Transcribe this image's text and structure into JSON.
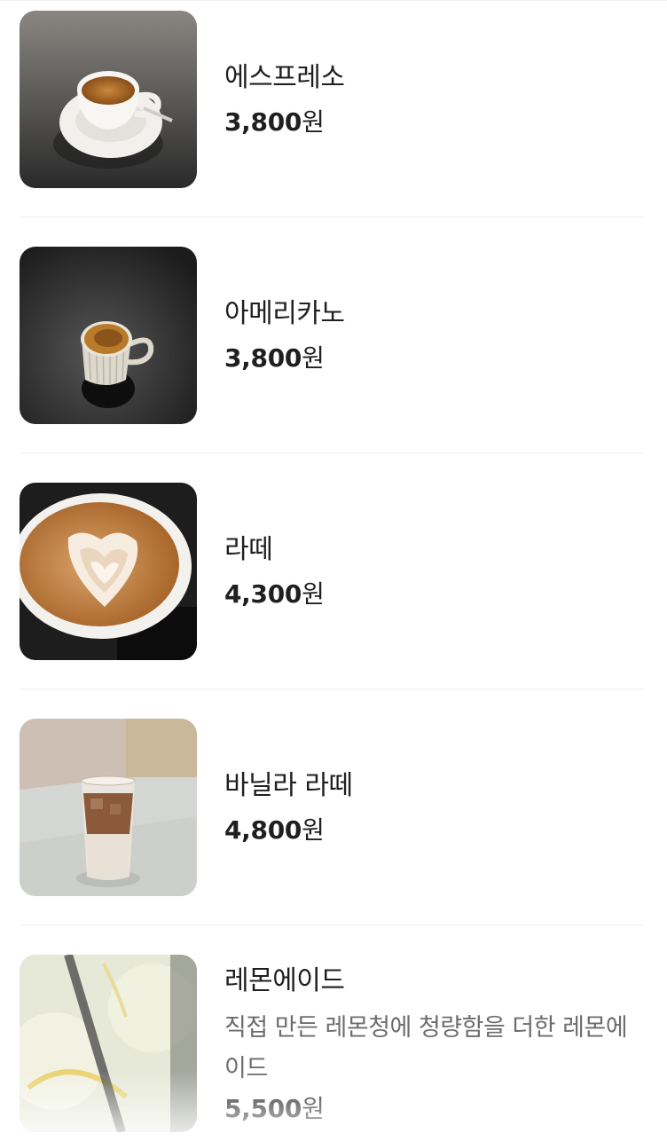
{
  "menu": {
    "items": [
      {
        "name": "에스프레소",
        "price": "3,800",
        "currency": "원",
        "image": "espresso-photo"
      },
      {
        "name": "아메리카노",
        "price": "3,800",
        "currency": "원",
        "image": "americano-photo"
      },
      {
        "name": "라떼",
        "price": "4,300",
        "currency": "원",
        "image": "latte-photo"
      },
      {
        "name": "바닐라 라떼",
        "price": "4,800",
        "currency": "원",
        "image": "vanilla-latte-photo"
      },
      {
        "name": "레몬에이드",
        "desc_line1": "직접 만든 레몬청에 청량함을 더한 레몬에",
        "desc_line2": "이드",
        "price": "5,500",
        "currency": "원",
        "image": "lemonade-photo"
      }
    ]
  },
  "colors": {
    "text_primary": "#1f1f1f",
    "text_secondary": "#6d6d6d",
    "divider": "#eeeeee"
  }
}
